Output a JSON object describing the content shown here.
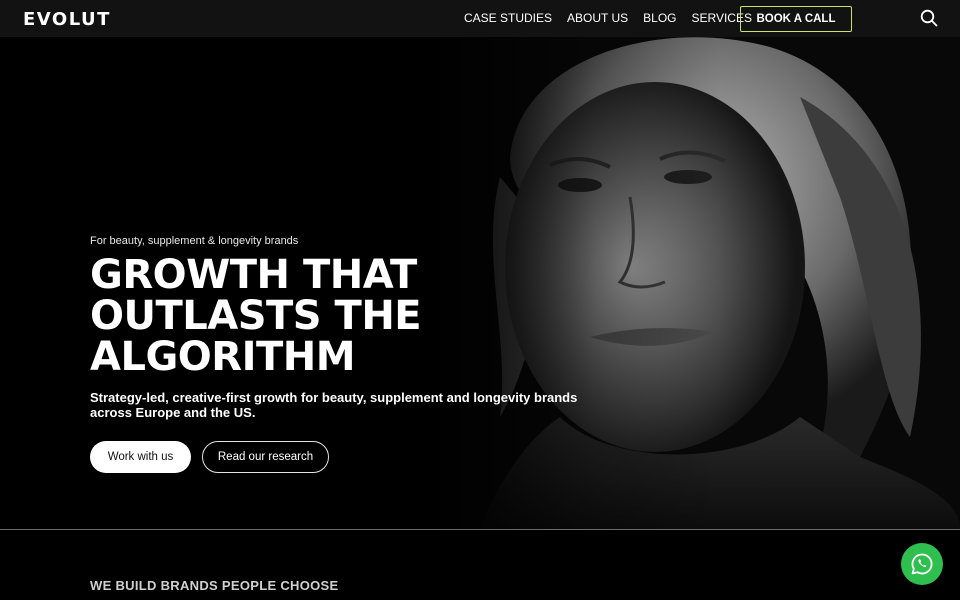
{
  "nav": {
    "logo": "EVOLUT",
    "links": [
      "CASE STUDIES",
      "ABOUT US",
      "BLOG",
      "SERVICES"
    ],
    "cta": "BOOK A CALL",
    "cta_border_color": "#c8e36a",
    "search_icon": "search-icon"
  },
  "hero": {
    "eyebrow": "For beauty, supplement & longevity brands",
    "headline": [
      "GROWTH THAT",
      "OUTLASTS THE",
      "ALGORITHM"
    ],
    "subhead": "Strategy-led, creative-first growth for beauty, supplement and longevity brands across Europe and the US.",
    "primary_button": "Work with us",
    "secondary_button": "Read our research"
  },
  "section": {
    "title": "WE BUILD BRANDS PEOPLE CHOOSE"
  },
  "floating": {
    "whatsapp_icon": "whatsapp-icon",
    "whatsapp_color": "#2fbf4e"
  }
}
